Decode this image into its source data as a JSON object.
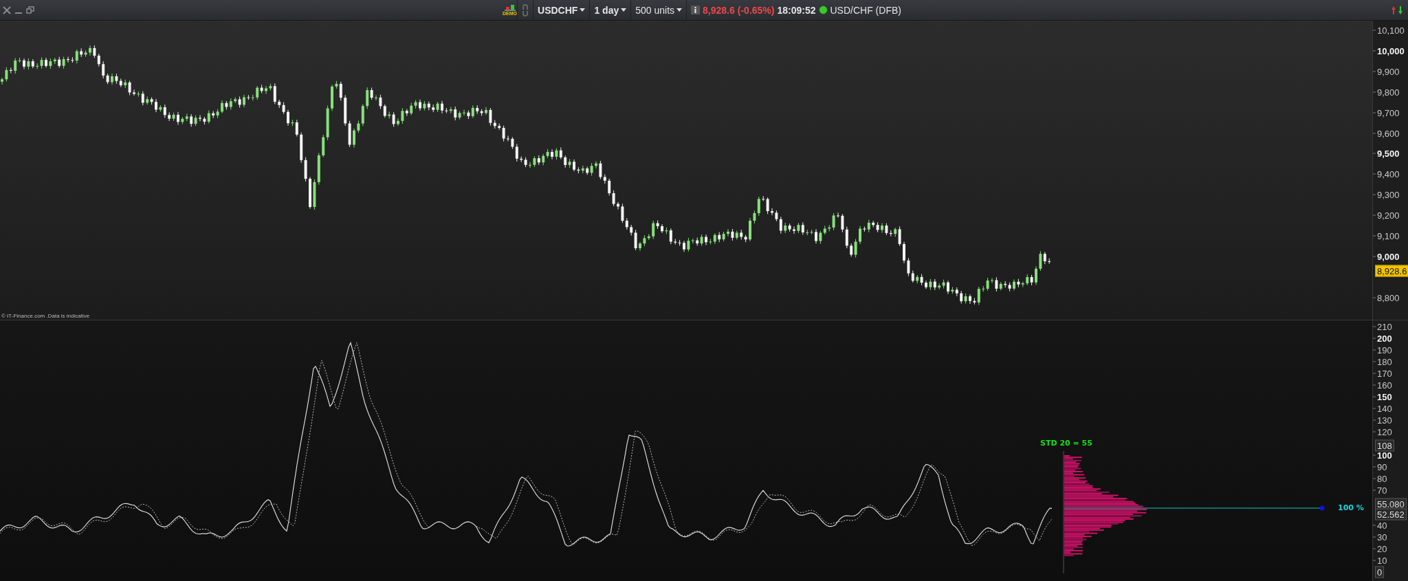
{
  "toolbar": {
    "badge": "DEMO",
    "symbol": "USDCHF",
    "period": "1 day",
    "quantity": "500 units",
    "price": "8,928.6",
    "change": "(-0.65%)",
    "time": "18:09:52",
    "market_open": true,
    "instrument": "USD/CHF (DFB)"
  },
  "price_pane": {
    "credit": "© IT-Finance.com .Data is indicative",
    "axis": [
      {
        "value": "10,100",
        "major": false
      },
      {
        "value": "10,000",
        "major": true
      },
      {
        "value": "9,900",
        "major": false
      },
      {
        "value": "9,800",
        "major": false
      },
      {
        "value": "9,700",
        "major": false
      },
      {
        "value": "9,600",
        "major": false
      },
      {
        "value": "9,500",
        "major": true
      },
      {
        "value": "9,400",
        "major": false
      },
      {
        "value": "9,300",
        "major": false
      },
      {
        "value": "9,200",
        "major": false
      },
      {
        "value": "9,100",
        "major": false
      },
      {
        "value": "9,000",
        "major": true
      },
      {
        "value": "8,800",
        "major": false
      }
    ],
    "last_price": "8,928.6"
  },
  "indicator_pane": {
    "label": "STD 20  = 55",
    "level_label": "100 %",
    "axis": [
      {
        "value": "210",
        "major": false
      },
      {
        "value": "200",
        "major": true
      },
      {
        "value": "190",
        "major": false
      },
      {
        "value": "180",
        "major": false
      },
      {
        "value": "170",
        "major": false
      },
      {
        "value": "160",
        "major": false
      },
      {
        "value": "150",
        "major": true
      },
      {
        "value": "140",
        "major": false
      },
      {
        "value": "130",
        "major": false
      },
      {
        "value": "120",
        "major": false
      },
      {
        "value": "100",
        "major": true
      },
      {
        "value": "90",
        "major": false
      },
      {
        "value": "80",
        "major": false
      },
      {
        "value": "70",
        "major": false
      },
      {
        "value": "40",
        "major": false
      },
      {
        "value": "30",
        "major": false
      },
      {
        "value": "20",
        "major": false
      },
      {
        "value": "10",
        "major": false
      }
    ],
    "markers": [
      {
        "value": "108"
      },
      {
        "value": "55.080"
      },
      {
        "value": "52.562"
      },
      {
        "value": "0"
      }
    ]
  }
}
